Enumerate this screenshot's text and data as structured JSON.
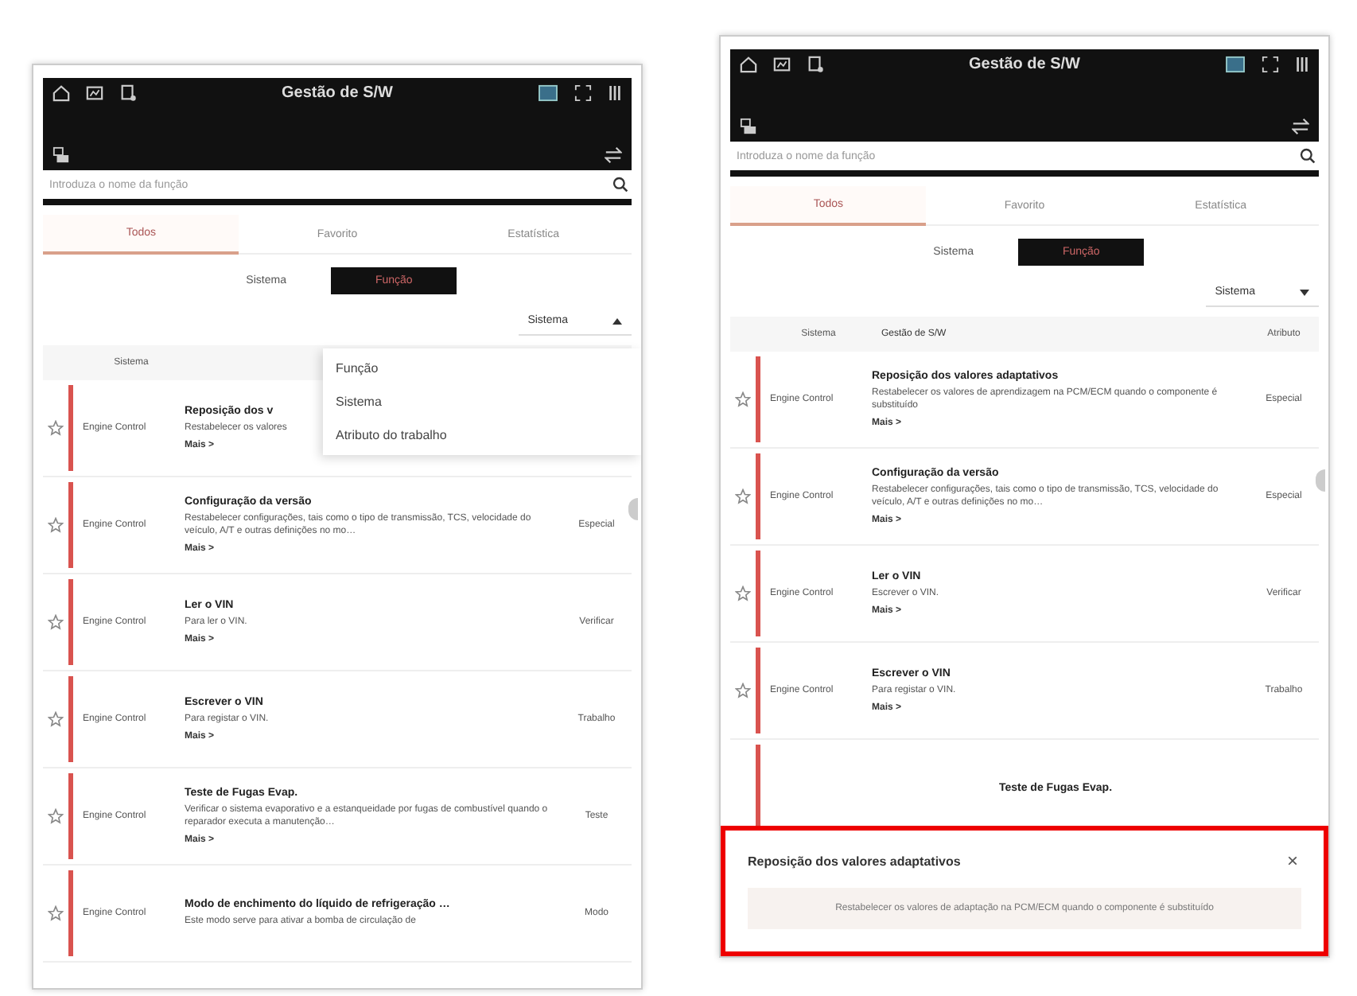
{
  "screens": [
    {
      "title": "Gestão de S/W",
      "search": {
        "placeholder": "Introduza o nome da função"
      },
      "tabs": [
        {
          "label": "Todos",
          "selected": true
        },
        {
          "label": "Favorito",
          "selected": false
        },
        {
          "label": "Estatística",
          "selected": false
        }
      ],
      "segments": [
        {
          "label": "Sistema",
          "selected": false
        },
        {
          "label": "Função",
          "selected": true
        }
      ],
      "sort": {
        "label": "Sistema",
        "expanded": true,
        "options": [
          "Função",
          "Sistema",
          "Atributo do trabalho"
        ]
      },
      "columns": [
        "Sistema"
      ],
      "rows": [
        {
          "system": "Engine Control",
          "title": "Reposição dos v",
          "description": "Restabelecer os valores",
          "more": "Mais >"
        },
        {
          "system": "Engine Control",
          "title": "Configuração da versão",
          "description": "Restabelecer configurações, tais como o tipo de transmissão, TCS, velocidade do veículo, A/T e outras definições no mo…",
          "more": "Mais >",
          "attribute": "Especial"
        },
        {
          "system": "Engine Control",
          "title": "Ler o VIN",
          "description": "Para ler o VIN.",
          "more": "Mais >",
          "attribute": "Verificar"
        },
        {
          "system": "Engine Control",
          "title": "Escrever o VIN",
          "description": "Para registar o VIN.",
          "more": "Mais >",
          "attribute": "Trabalho"
        },
        {
          "system": "Engine Control",
          "title": "Teste de Fugas Evap.",
          "description": "Verificar o sistema evaporativo e a estanqueidade por fugas de combustível quando o reparador executa a manutenção…",
          "more": "Mais >",
          "attribute": "Teste"
        },
        {
          "system": "Engine Control",
          "title": "Modo de enchimento do líquido de refrigeração …",
          "description": "Este modo serve para ativar a bomba de circulação de",
          "attribute": "Modo"
        }
      ]
    },
    {
      "title": "Gestão de S/W",
      "search": {
        "placeholder": "Introduza o nome da função"
      },
      "tabs": [
        {
          "label": "Todos",
          "selected": true
        },
        {
          "label": "Favorito",
          "selected": false
        },
        {
          "label": "Estatística",
          "selected": false
        }
      ],
      "segments": [
        {
          "label": "Sistema",
          "selected": false
        },
        {
          "label": "Função",
          "selected": true
        }
      ],
      "sort": {
        "label": "Sistema",
        "expanded": false
      },
      "columns": [
        "Sistema",
        "Gestão de S/W",
        "Atributo"
      ],
      "rows": [
        {
          "system": "Engine Control",
          "title": "Reposição dos valores adaptativos",
          "description": "Restabelecer os valores de aprendizagem na PCM/ECM quando o componente é substituído",
          "more": "Mais >",
          "attribute": "Especial"
        },
        {
          "system": "Engine Control",
          "title": "Configuração da versão",
          "description": "Restabelecer configurações, tais como o tipo de transmissão, TCS, velocidade do veículo, A/T e outras definições no mo…",
          "more": "Mais >",
          "attribute": "Especial"
        },
        {
          "system": "Engine Control",
          "title": "Ler o VIN",
          "description": "Escrever o VIN.",
          "more": "Mais >",
          "attribute": "Verificar"
        },
        {
          "system": "Engine Control",
          "title": "Escrever o VIN",
          "description": "Para registar o VIN.",
          "more": "Mais >",
          "attribute": "Trabalho"
        },
        {
          "title": "Teste de Fugas Evap."
        }
      ],
      "sheet": {
        "title": "Reposição dos valores adaptativos",
        "close": "×",
        "body": "Restabelecer os valores de adaptação na PCM/ECM quando o componente é substituído",
        "highlighted": true
      }
    }
  ]
}
